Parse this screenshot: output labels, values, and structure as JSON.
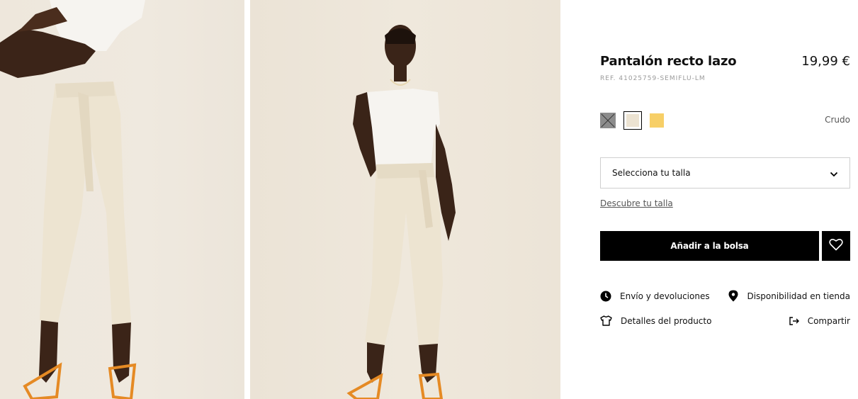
{
  "product": {
    "title": "Pantalón recto lazo",
    "price": "19,99 €",
    "reference": "REF. 41025759-SEMIFLU-LM"
  },
  "colors": {
    "selected_name": "Crudo",
    "swatches": [
      {
        "name": "grey",
        "hex": "#8c8c8c",
        "available": false
      },
      {
        "name": "cream",
        "hex": "#ece3d2",
        "available": true,
        "selected": true
      },
      {
        "name": "yellow",
        "hex": "#f7cf67",
        "available": true
      }
    ]
  },
  "size": {
    "placeholder": "Selecciona tu talla",
    "guide_link": "Descubre tu talla"
  },
  "actions": {
    "add_to_bag": "Añadir a la bolsa"
  },
  "info_links": {
    "shipping": "Envío y devoluciones",
    "store_availability": "Disponibilidad en tienda",
    "product_details": "Detalles del producto",
    "share": "Compartir"
  }
}
